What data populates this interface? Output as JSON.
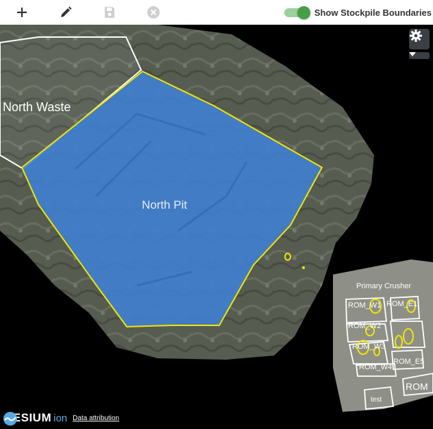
{
  "toolbar": {
    "add_icon": "plus-icon",
    "edit_icon": "pencil-icon",
    "save_icon": "floppy-disk-icon",
    "cancel_icon": "circle-x-icon",
    "toggle_label": "Show Stockpile Boundaries",
    "toggle_state": true
  },
  "map": {
    "labels": {
      "north_waste": "North Waste",
      "north_pit": "North Pit",
      "primary_crusher": "Primary Crusher",
      "rom_w1": "ROM_W1",
      "rom_w2": "ROM_W2",
      "rom_w3": "ROM_W3",
      "rom_w4": "ROM_W4",
      "rom_e1": "ROM_E1",
      "rom_e5": "ROM_E5",
      "test": "test",
      "rom_cut": "ROM"
    },
    "settings_icon": "gear-icon",
    "expand_icon": "caret-down-icon"
  },
  "footer": {
    "logo_word": "CESIUM",
    "logo_sub": "ion",
    "attribution_link": "Data attribution"
  },
  "colors": {
    "accent_green": "#43a047",
    "pit_fill": "#3f7fd0",
    "boundary_yellow": "#f2e600"
  }
}
